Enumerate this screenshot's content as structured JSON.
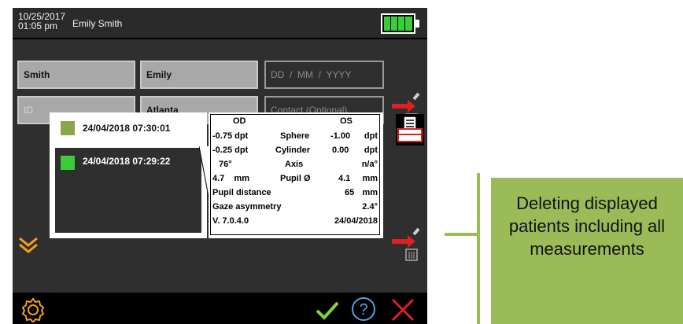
{
  "header": {
    "date": "10/25/2017",
    "time": "01:05 pm",
    "user": "Emily Smith",
    "battery_level": 1.0
  },
  "form": {
    "last_name": "Smith",
    "first_name": "Emily",
    "dob_placeholder": "DD  /  MM  /  YYYY",
    "id_placeholder": "ID",
    "city": "Atlanta",
    "contact_placeholder": "Contact (Optional)"
  },
  "records": [
    {
      "label": "24/04/2018 07:30:01"
    },
    {
      "label": "24/04/2018 07:29:22"
    }
  ],
  "measurements": {
    "od_header": "OD",
    "os_header": "OS",
    "rows": [
      {
        "od": "-0.75 dpt",
        "name": "Sphere",
        "os_val": "-1.00",
        "os_unit": "dpt"
      },
      {
        "od": "-0.25 dpt",
        "name": "Cylinder",
        "os_val": "0.00",
        "os_unit": "dpt"
      },
      {
        "od": "76°",
        "name": "Axis",
        "os_val": "",
        "os_unit": "n/a°"
      },
      {
        "od": "4.7    mm",
        "name": "Pupil Ø",
        "os_val": "4.1",
        "os_unit": "mm"
      }
    ],
    "pupil_distance_label": "Pupil distance",
    "pupil_distance_val": "65",
    "pupil_distance_unit": "mm",
    "gaze_label": "Gaze asymmetry",
    "gaze_val": "2.4°",
    "version": "V. 7.0.4.0",
    "version_date": "24/04/2018"
  },
  "callout": {
    "text": "Deleting displayed patients including all measurements"
  },
  "colors": {
    "accent_green": "#9bbb59",
    "orange": "#f0a020",
    "red": "#e02020",
    "check_green": "#7dd63a",
    "question_blue": "#4fa3e0"
  }
}
